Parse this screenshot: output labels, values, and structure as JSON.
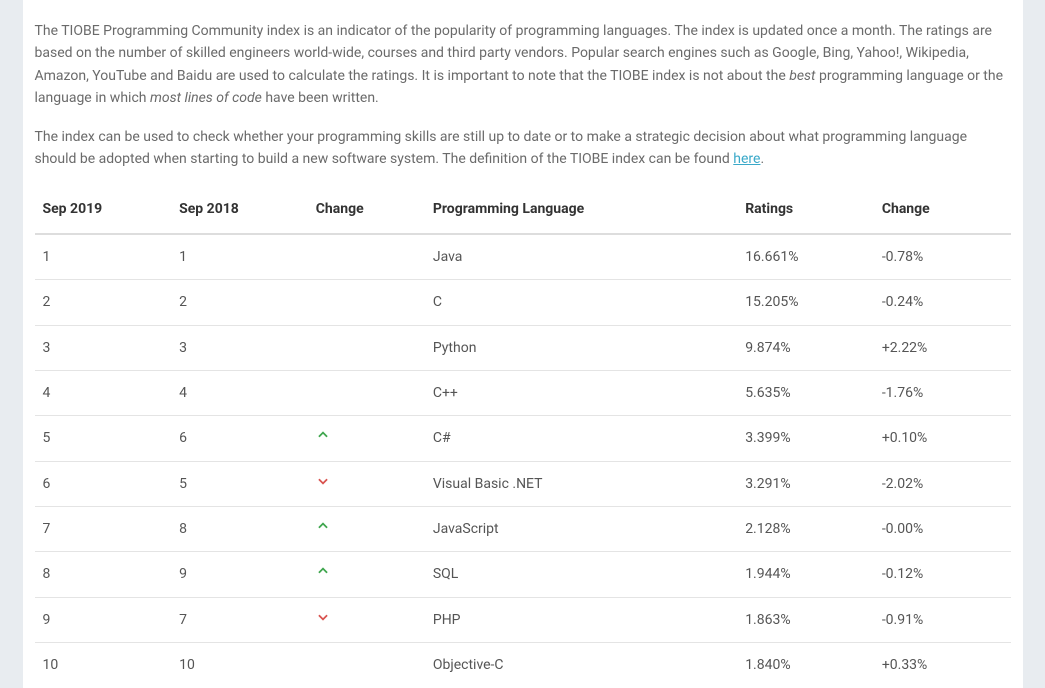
{
  "intro": {
    "p1_before_best": "The TIOBE Programming Community index is an indicator of the popularity of programming languages. The index is updated once a month. The ratings are based on the number of skilled engineers world-wide, courses and third party vendors. Popular search engines such as Google, Bing, Yahoo!, Wikipedia, Amazon, YouTube and Baidu are used to calculate the ratings. It is important to note that the TIOBE index is not about the ",
    "em_best": "best",
    "p1_between": " programming language or the language in which ",
    "em_lines": "most lines of code",
    "p1_after": " have been written.",
    "p2_before_link": "The index can be used to check whether your programming skills are still up to date or to make a strategic decision about what programming language should be adopted when starting to build a new software system. The definition of the TIOBE index can be found ",
    "link_text": "here",
    "p2_after": "."
  },
  "table": {
    "headers": {
      "c1": "Sep 2019",
      "c2": "Sep 2018",
      "c3": "Change",
      "c4": "Programming Language",
      "c5": "Ratings",
      "c6": "Change"
    },
    "rows": [
      {
        "r2019": "1",
        "r2018": "1",
        "dir": "",
        "lang": "Java",
        "ratings": "16.661%",
        "delta": "-0.78%"
      },
      {
        "r2019": "2",
        "r2018": "2",
        "dir": "",
        "lang": "C",
        "ratings": "15.205%",
        "delta": "-0.24%"
      },
      {
        "r2019": "3",
        "r2018": "3",
        "dir": "",
        "lang": "Python",
        "ratings": "9.874%",
        "delta": "+2.22%"
      },
      {
        "r2019": "4",
        "r2018": "4",
        "dir": "",
        "lang": "C++",
        "ratings": "5.635%",
        "delta": "-1.76%"
      },
      {
        "r2019": "5",
        "r2018": "6",
        "dir": "up",
        "lang": "C#",
        "ratings": "3.399%",
        "delta": "+0.10%"
      },
      {
        "r2019": "6",
        "r2018": "5",
        "dir": "down",
        "lang": "Visual Basic .NET",
        "ratings": "3.291%",
        "delta": "-2.02%"
      },
      {
        "r2019": "7",
        "r2018": "8",
        "dir": "up",
        "lang": "JavaScript",
        "ratings": "2.128%",
        "delta": "-0.00%"
      },
      {
        "r2019": "8",
        "r2018": "9",
        "dir": "up",
        "lang": "SQL",
        "ratings": "1.944%",
        "delta": "-0.12%"
      },
      {
        "r2019": "9",
        "r2018": "7",
        "dir": "down",
        "lang": "PHP",
        "ratings": "1.863%",
        "delta": "-0.91%"
      },
      {
        "r2019": "10",
        "r2018": "10",
        "dir": "",
        "lang": "Objective-C",
        "ratings": "1.840%",
        "delta": "+0.33%"
      }
    ]
  }
}
